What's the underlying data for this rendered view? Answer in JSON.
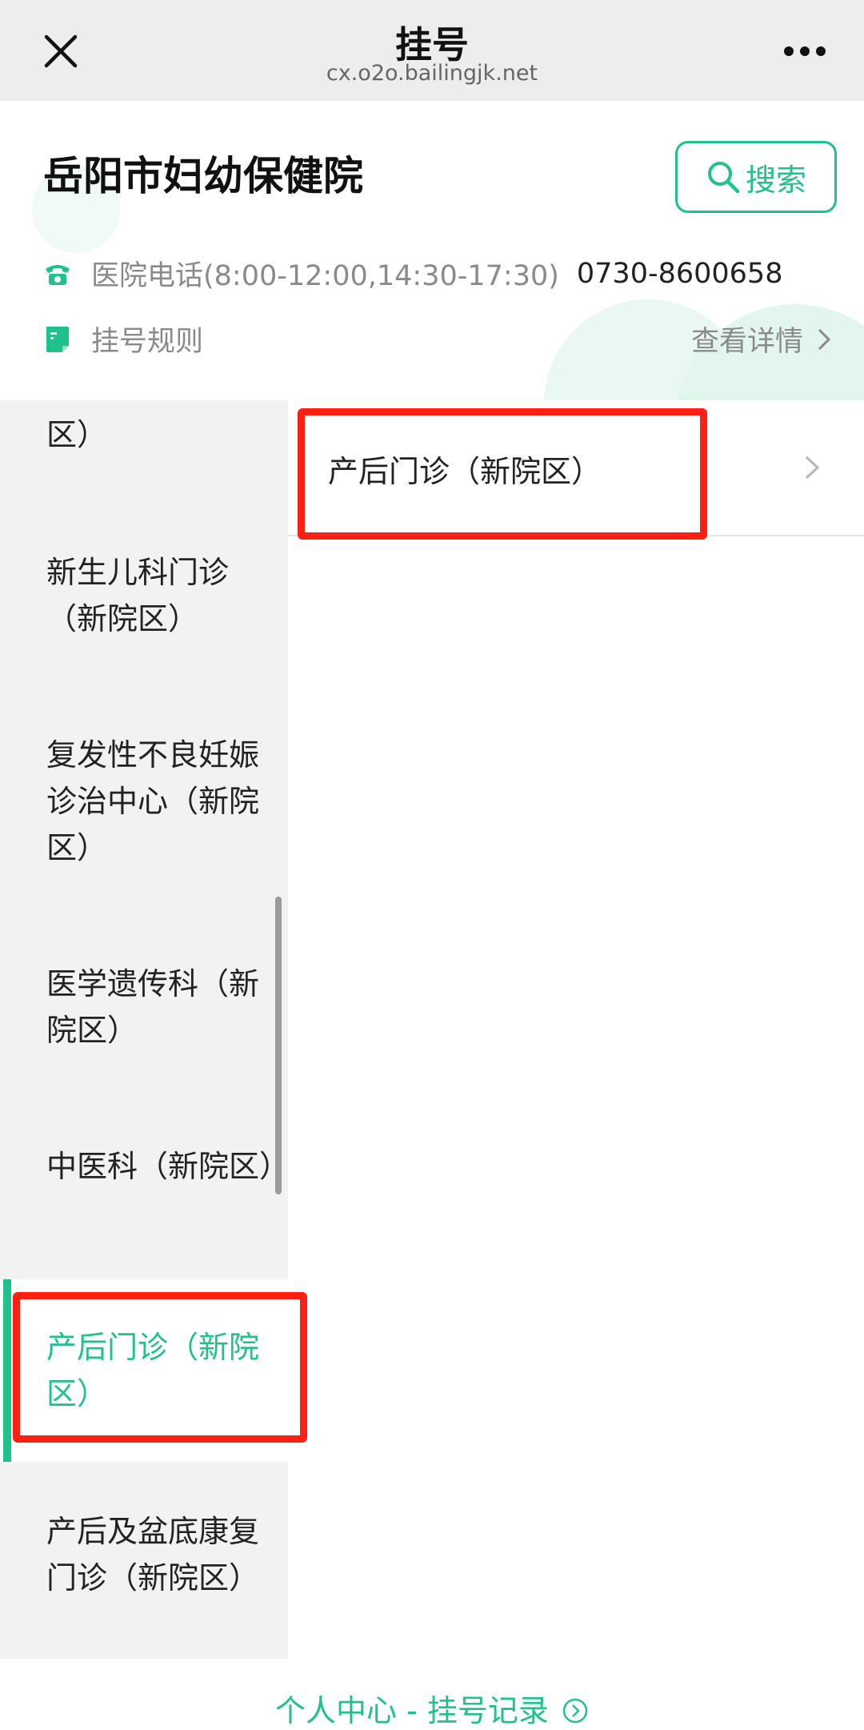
{
  "nav": {
    "title": "挂号",
    "url": "cx.o2o.bailingjk.net",
    "close_icon": "close-icon",
    "more_icon": "more-icon"
  },
  "hospital": {
    "name": "岳阳市妇幼保健院",
    "search_label": "搜索",
    "phone_label": "医院电话(8:00-12:00,14:30-17:30)",
    "phone_number": "0730-8600658",
    "rules_label": "挂号规则",
    "detail_label": "查看详情"
  },
  "sidebar": {
    "items": [
      {
        "label": "区）"
      },
      {
        "label": "新生儿科门诊（新院区）"
      },
      {
        "label": "复发性不良妊娠诊治中心（新院区）"
      },
      {
        "label": "医学遗传科（新院区）"
      },
      {
        "label": "中医科（新院区）"
      },
      {
        "label": "产后门诊（新院区）"
      },
      {
        "label": "产后及盆底康复门诊（新院区）"
      }
    ]
  },
  "departments": [
    {
      "label": "产后门诊（新院区）"
    }
  ],
  "footer": {
    "link_label": "个人中心 - 挂号记录"
  },
  "colors": {
    "accent": "#1fc28b",
    "highlight": "#ff2013",
    "sidebar_bg": "#f2f2f2",
    "navbar_bg": "#ededed"
  }
}
